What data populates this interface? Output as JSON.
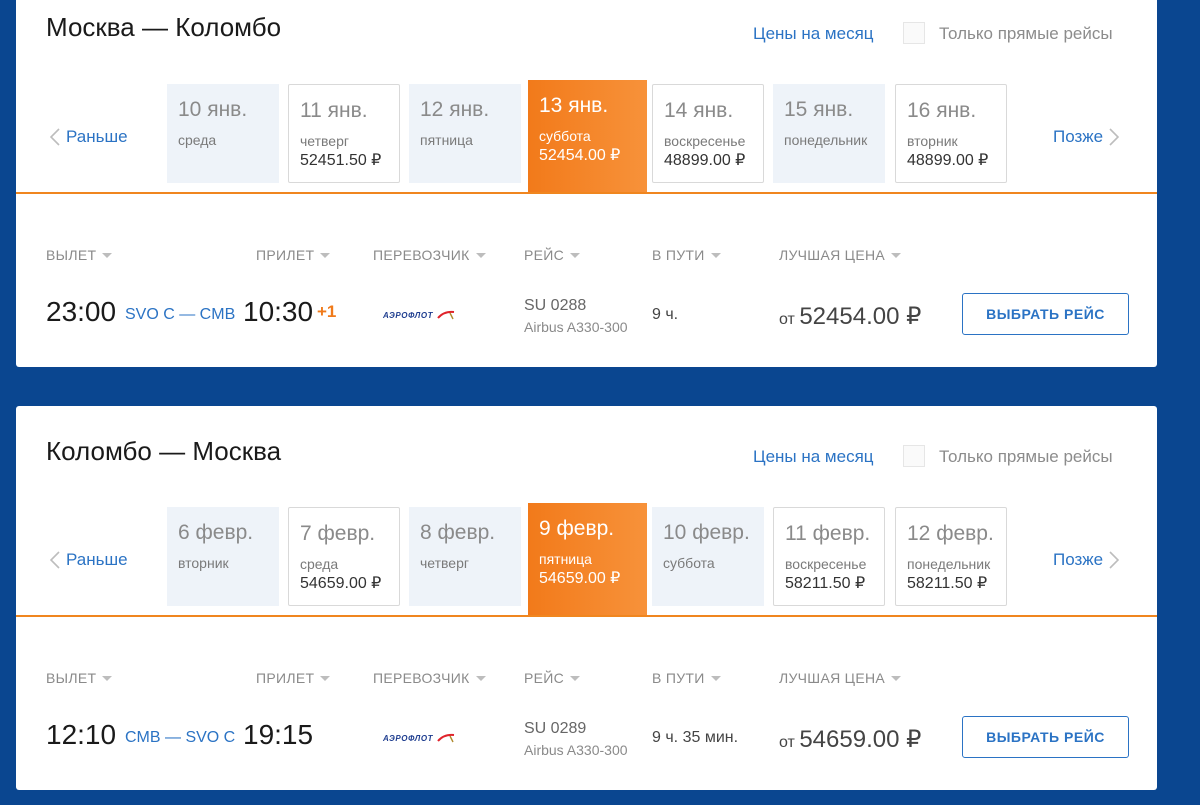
{
  "common": {
    "month_link": "Цены на месяц",
    "direct_label": "Только прямые рейсы",
    "prev_label": "Раньше",
    "next_label": "Позже",
    "col_departure": "ВЫЛЕТ",
    "col_arrival": "ПРИЛЕТ",
    "col_carrier": "ПЕРЕВОЗЧИК",
    "col_flight": "РЕЙС",
    "col_duration": "В ПУТИ",
    "col_price": "ЛУЧШАЯ ЦЕНА",
    "select_button": "ВЫБРАТЬ РЕЙС",
    "price_prefix": "от",
    "carrier_logo_text": "АЭРОФЛОТ"
  },
  "outbound": {
    "title": "Москва — Коломбо",
    "dates": [
      {
        "date": "10 янв.",
        "dow": "среда",
        "price": "",
        "state": "plain"
      },
      {
        "date": "11 янв.",
        "dow": "четверг",
        "price": "52451.50 ₽",
        "state": "bordered"
      },
      {
        "date": "12 янв.",
        "dow": "пятница",
        "price": "",
        "state": "plain"
      },
      {
        "date": "13 янв.",
        "dow": "суббота",
        "price": "52454.00 ₽",
        "state": "selected"
      },
      {
        "date": "14 янв.",
        "dow": "воскресенье",
        "price": "48899.00 ₽",
        "state": "bordered"
      },
      {
        "date": "15 янв.",
        "dow": "понедельник",
        "price": "",
        "state": "plain"
      },
      {
        "date": "16 янв.",
        "dow": "вторник",
        "price": "48899.00 ₽",
        "state": "bordered"
      }
    ],
    "flight": {
      "dep_time": "23:00",
      "airports": "SVO C — CMB",
      "arr_time": "10:30",
      "plus_day": "+1",
      "flight_no": "SU 0288",
      "aircraft": "Airbus A330-300",
      "duration": "9 ч.",
      "price": "52454.00 ₽"
    }
  },
  "return": {
    "title": "Коломбо — Москва",
    "dates": [
      {
        "date": "6 февр.",
        "dow": "вторник",
        "price": "",
        "state": "plain"
      },
      {
        "date": "7 февр.",
        "dow": "среда",
        "price": "54659.00 ₽",
        "state": "bordered"
      },
      {
        "date": "8 февр.",
        "dow": "четверг",
        "price": "",
        "state": "plain"
      },
      {
        "date": "9 февр.",
        "dow": "пятница",
        "price": "54659.00 ₽",
        "state": "selected"
      },
      {
        "date": "10 февр.",
        "dow": "суббота",
        "price": "",
        "state": "plain"
      },
      {
        "date": "11 февр.",
        "dow": "воскресенье",
        "price": "58211.50 ₽",
        "state": "bordered"
      },
      {
        "date": "12 февр.",
        "dow": "понедельник",
        "price": "58211.50 ₽",
        "state": "bordered"
      }
    ],
    "flight": {
      "dep_time": "12:10",
      "airports": "CMB — SVO C",
      "arr_time": "19:15",
      "plus_day": "",
      "flight_no": "SU 0289",
      "aircraft": "Airbus A330-300",
      "duration": "9 ч. 35 мин.",
      "price": "54659.00 ₽"
    }
  },
  "colors": {
    "background": "#0a4690",
    "accent_orange": "#f27a1a",
    "link_blue": "#2b73c4"
  }
}
